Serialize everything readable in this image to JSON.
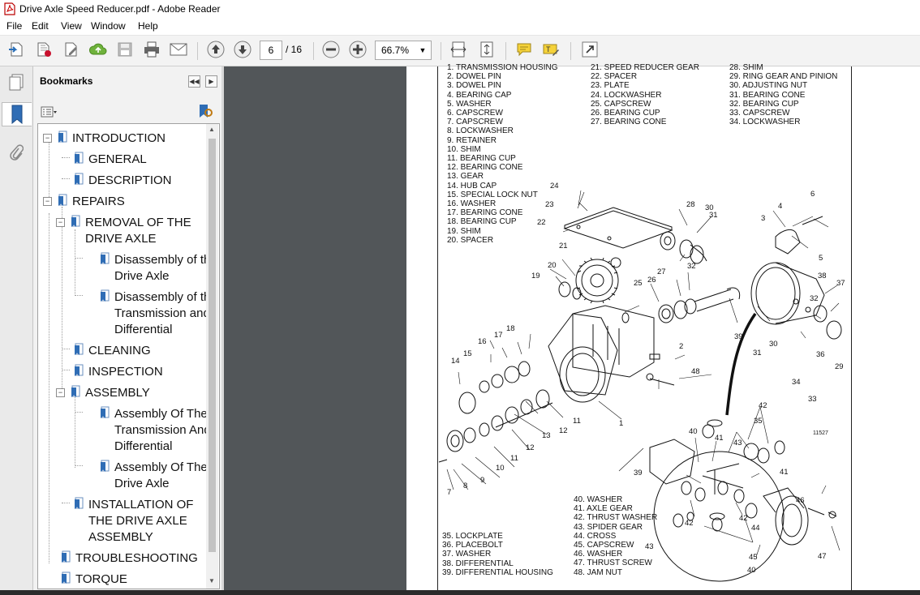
{
  "window": {
    "title": "Drive Axle Speed Reducer.pdf - Adobe Reader"
  },
  "menu": [
    "File",
    "Edit",
    "View",
    "Window",
    "Help"
  ],
  "toolbar": {
    "page_current": "6",
    "page_total": "/ 16",
    "zoom": "66.7%"
  },
  "bookmarks": {
    "header": "Bookmarks",
    "items": [
      {
        "label": "INTRODUCTION",
        "level": 0,
        "expander": "−"
      },
      {
        "label": "GENERAL",
        "level": 1
      },
      {
        "label": "DESCRIPTION",
        "level": 1
      },
      {
        "label": "REPAIRS",
        "level": 0,
        "expander": "−"
      },
      {
        "label": "REMOVAL OF THE\nDRIVE AXLE",
        "level": 1,
        "expander": "−"
      },
      {
        "label": "Disassembly of the\nDrive Axle",
        "level": 2
      },
      {
        "label": "Disassembly of the\nTransmission and\nDifferential",
        "level": 2
      },
      {
        "label": "CLEANING",
        "level": 1
      },
      {
        "label": "INSPECTION",
        "level": 1
      },
      {
        "label": "ASSEMBLY",
        "level": 1,
        "expander": "−"
      },
      {
        "label": "Assembly Of The\nTransmission And\nDifferential",
        "level": 2
      },
      {
        "label": "Assembly Of The\nDrive Axle",
        "level": 2
      },
      {
        "label": "INSTALLATION OF\nTHE DRIVE AXLE\nASSEMBLY",
        "level": 1
      },
      {
        "label": "TROUBLESHOOTING",
        "level": 0
      },
      {
        "label": "TORQUE",
        "level": 0
      }
    ]
  },
  "document": {
    "legend_col1": "1. TRANSMISSION HOUSING\n2. DOWEL PIN\n3. DOWEL PIN\n4. BEARING CAP\n5. WASHER\n6. CAPSCREW\n7. CAPSCREW\n8. LOCKWASHER\n9. RETAINER\n10. SHIM\n11. BEARING CUP\n12. BEARING CONE\n13. GEAR\n14. HUB CAP\n15. SPECIAL LOCK NUT\n16. WASHER\n17. BEARING CONE\n18. BEARING CUP\n19. SHIM\n20. SPACER",
    "legend_col2": "21. SPEED REDUCER GEAR\n22. SPACER\n23. PLATE\n24. LOCKWASHER\n25. CAPSCREW\n26. BEARING CUP\n27. BEARING CONE",
    "legend_col3": "28. SHIM\n29. RING GEAR AND PINION\n30. ADJUSTING NUT\n31. BEARING CONE\n32. BEARING CUP\n33. CAPSCREW\n34. LOCKWASHER",
    "legend_bottom_left": "35. LOCKPLATE\n36. PLACEBOLT\n37. WASHER\n38. DIFFERENTIAL\n39. DIFFERENTIAL HOUSING",
    "legend_bottom_right": "40. WASHER\n41. AXLE GEAR\n42. THRUST WASHER\n43. SPIDER GEAR\n44. CROSS\n45. CAPSCREW\n46. WASHER\n47. THRUST SCREW\n48. JAM NUT",
    "figure_id": "11527",
    "callouts": [
      "1",
      "2",
      "3",
      "4",
      "5",
      "6",
      "7",
      "8",
      "9",
      "10",
      "11",
      "11",
      "12",
      "12",
      "13",
      "14",
      "15",
      "16",
      "17",
      "18",
      "19",
      "20",
      "21",
      "22",
      "23",
      "24",
      "25",
      "26",
      "27",
      "28",
      "29",
      "30",
      "30",
      "31",
      "31",
      "32",
      "32",
      "33",
      "34",
      "35",
      "36",
      "37",
      "38",
      "39",
      "39",
      "40",
      "40",
      "41",
      "41",
      "42",
      "42",
      "42",
      "43",
      "43",
      "44",
      "45",
      "46",
      "47",
      "48"
    ]
  },
  "colors": {
    "doc_background": "#525659",
    "page": "#ffffff",
    "accent_red": "#c8102e"
  }
}
